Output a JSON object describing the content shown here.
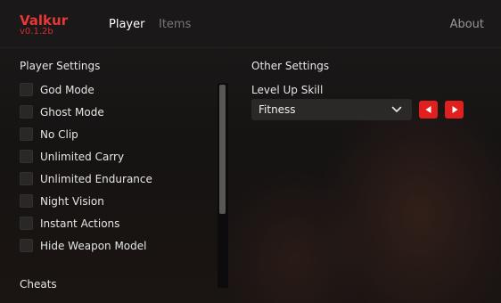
{
  "brand": {
    "name": "Valkur",
    "version": "v0.1.2b"
  },
  "nav": {
    "tabs": [
      {
        "label": "Player",
        "active": true
      },
      {
        "label": "Items",
        "active": false
      }
    ],
    "about": "About"
  },
  "player_settings": {
    "title": "Player Settings",
    "options": [
      {
        "label": "God Mode",
        "checked": false
      },
      {
        "label": "Ghost Mode",
        "checked": false
      },
      {
        "label": "No Clip",
        "checked": false
      },
      {
        "label": "Unlimited Carry",
        "checked": false
      },
      {
        "label": "Unlimited Endurance",
        "checked": false
      },
      {
        "label": "Night Vision",
        "checked": false
      },
      {
        "label": "Instant Actions",
        "checked": false
      },
      {
        "label": "Hide Weapon Model",
        "checked": false
      }
    ]
  },
  "cheats": {
    "title": "Cheats"
  },
  "other_settings": {
    "title": "Other Settings",
    "level_up_label": "Level Up Skill",
    "skill_value": "Fitness"
  },
  "colors": {
    "accent": "#e01f1f",
    "brand": "#e53935",
    "bg": "#161313"
  },
  "icons": {
    "dropdown": "chevron-down-icon",
    "prev": "triangle-left-icon",
    "next": "triangle-right-icon"
  }
}
